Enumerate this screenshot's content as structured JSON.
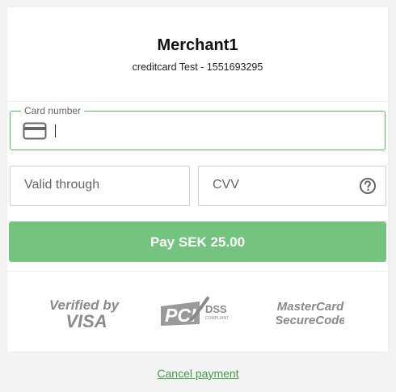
{
  "header": {
    "merchant": "Merchant1",
    "subtitle": "creditcard Test - 1551693295"
  },
  "form": {
    "card_number_label": "Card number",
    "card_number_value": "",
    "valid_through_placeholder": "Valid through",
    "cvv_placeholder": "CVV",
    "pay_button": "Pay SEK 25.00"
  },
  "logos": {
    "verified_by": "Verified by",
    "visa": "VISA",
    "pci": "PCI",
    "dss": "DSS",
    "compliant": "COMPLIANT",
    "mastercard": "MasterCard",
    "securecode": "SecureCode"
  },
  "footer": {
    "cancel": "Cancel payment"
  },
  "icons": {
    "card": "credit-card-icon",
    "help": "help-circle-icon"
  },
  "colors": {
    "accent": "#5cb85c",
    "pay_button": "#74c47f",
    "cancel_link": "#3fa04a",
    "logo_gray": "#8a8a8a"
  }
}
